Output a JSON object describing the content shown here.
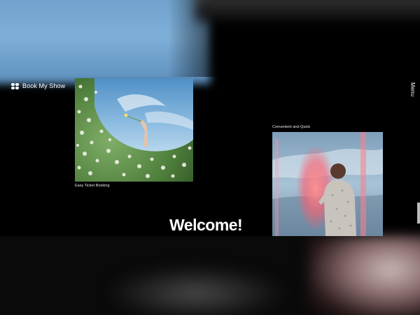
{
  "header": {
    "brand": "Book My Show",
    "brand_icon": "logo-grid-icon",
    "menu_label": "Menu"
  },
  "cards": [
    {
      "caption": "Easy Ticket Booking",
      "image": "hand-holding-flower-through-hedge-photo"
    },
    {
      "caption": "Convenient and Quick",
      "image": "person-in-red-light-sky-photo"
    }
  ],
  "hero": {
    "title": "Welcome!"
  },
  "colors": {
    "background": "#000000",
    "text": "#ffffff"
  }
}
